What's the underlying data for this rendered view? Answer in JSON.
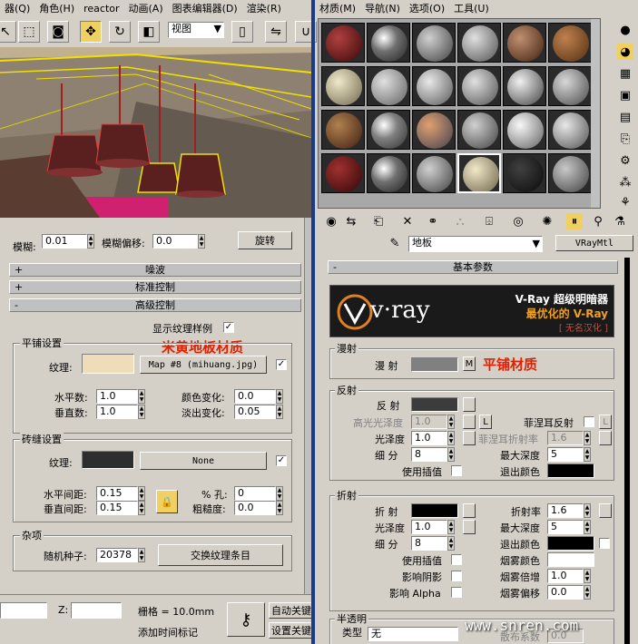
{
  "left_menu": [
    "器(Q)",
    "角色(H)",
    "reactor",
    "动画(A)",
    "图表编辑器(D)",
    "渲染(R)"
  ],
  "right_menu": [
    "材质(M)",
    "导航(N)",
    "选项(O)",
    "工具(U)"
  ],
  "viewport_dropdown": "视图",
  "left_panel": {
    "blur_label": "模糊:",
    "blur_value": "0.01",
    "blur_offset_label": "模糊偏移:",
    "blur_offset_value": "0.0",
    "rotate_button": "旋转",
    "rollouts": [
      "噪波",
      "标准控制",
      "高级控制"
    ],
    "show_texture_label": "显示纹理样例",
    "annotation_floor": "米黄地板材质",
    "tile_group": {
      "title": "平铺设置",
      "texture_label": "纹理:",
      "map_button": "Map #8  (mihuang.jpg)",
      "h_count_label": "水平数:",
      "h_count": "1.0",
      "v_count_label": "垂直数:",
      "v_count": "1.0",
      "color_var_label": "颜色变化:",
      "color_var": "0.0",
      "fade_var_label": "淡出变化:",
      "fade_var": "0.05"
    },
    "grout_group": {
      "title": "砖缝设置",
      "texture_label": "纹理:",
      "map_button": "None",
      "h_gap_label": "水平间距:",
      "h_gap": "0.15",
      "v_gap_label": "垂直间距:",
      "v_gap": "0.15",
      "holes_label": "% 孔:",
      "holes": "0",
      "rough_label": "粗糙度:",
      "rough": "0.0"
    },
    "misc_group": {
      "title": "杂项",
      "seed_label": "随机种子:",
      "seed": "20378",
      "swap_button": "交换纹理条目"
    }
  },
  "status": {
    "z_label": "Z:",
    "grid_label": "栅格 = 10.0mm",
    "add_time_tag": "添加时间标记",
    "auto_key": "自动关键",
    "set_key": "设置关键"
  },
  "mat_editor": {
    "material_name": "地板",
    "material_type": "VRayMtl",
    "basic_params": "基本参数",
    "vray_title": "V-Ray 超级明暗器",
    "vray_sub": "最优化的 V-Ray",
    "vray_tag": "[ 无名汉化 ]",
    "vray_logo": "v·ray",
    "diffuse_group": "漫射",
    "diffuse_label": "漫  射",
    "diffuse_map_btn": "M",
    "annotation_tile": "平铺材质",
    "reflect_group": "反射",
    "reflect_label": "反  射",
    "hilight_gloss_label": "高光光泽度",
    "hilight_gloss": "1.0",
    "lock_btn": "L",
    "fresnel_label": "菲涅耳反射",
    "refl_gloss_label": "光泽度",
    "refl_gloss": "1.0",
    "fresnel_ior_label": "菲涅耳折射率",
    "fresnel_ior": "1.6",
    "subdivs_label": "细  分",
    "subdivs": "8",
    "max_depth_label": "最大深度",
    "max_depth": "5",
    "use_interp_label": "使用插值",
    "exit_color_label": "退出颜色",
    "refract_group": "折射",
    "refract_label": "折  射",
    "ior_label": "折射率",
    "ior": "1.6",
    "refr_gloss_label": "光泽度",
    "refr_gloss": "1.0",
    "refr_max_depth_label": "最大深度",
    "refr_max_depth": "5",
    "refr_subdivs_label": "细  分",
    "refr_subdivs": "8",
    "refr_exit_color_label": "退出颜色",
    "refr_use_interp_label": "使用插值",
    "fog_color_label": "烟雾颜色",
    "affect_shadow_label": "影响阴影",
    "fog_mult_label": "烟雾倍增",
    "fog_mult": "1.0",
    "affect_alpha_label": "影响 Alpha",
    "fog_bias_label": "烟雾偏移",
    "fog_bias": "0.0",
    "translucent_group": "半透明",
    "type_label": "类型",
    "type_value": "无",
    "scatter_label": "散布系数",
    "scatter_value": "0.0"
  },
  "watermark": "www.snren.com",
  "colors": {
    "accent_yellow": "#f0d060",
    "annotation_red": "#e02000",
    "viewport_bg": "#8a7a6a"
  }
}
